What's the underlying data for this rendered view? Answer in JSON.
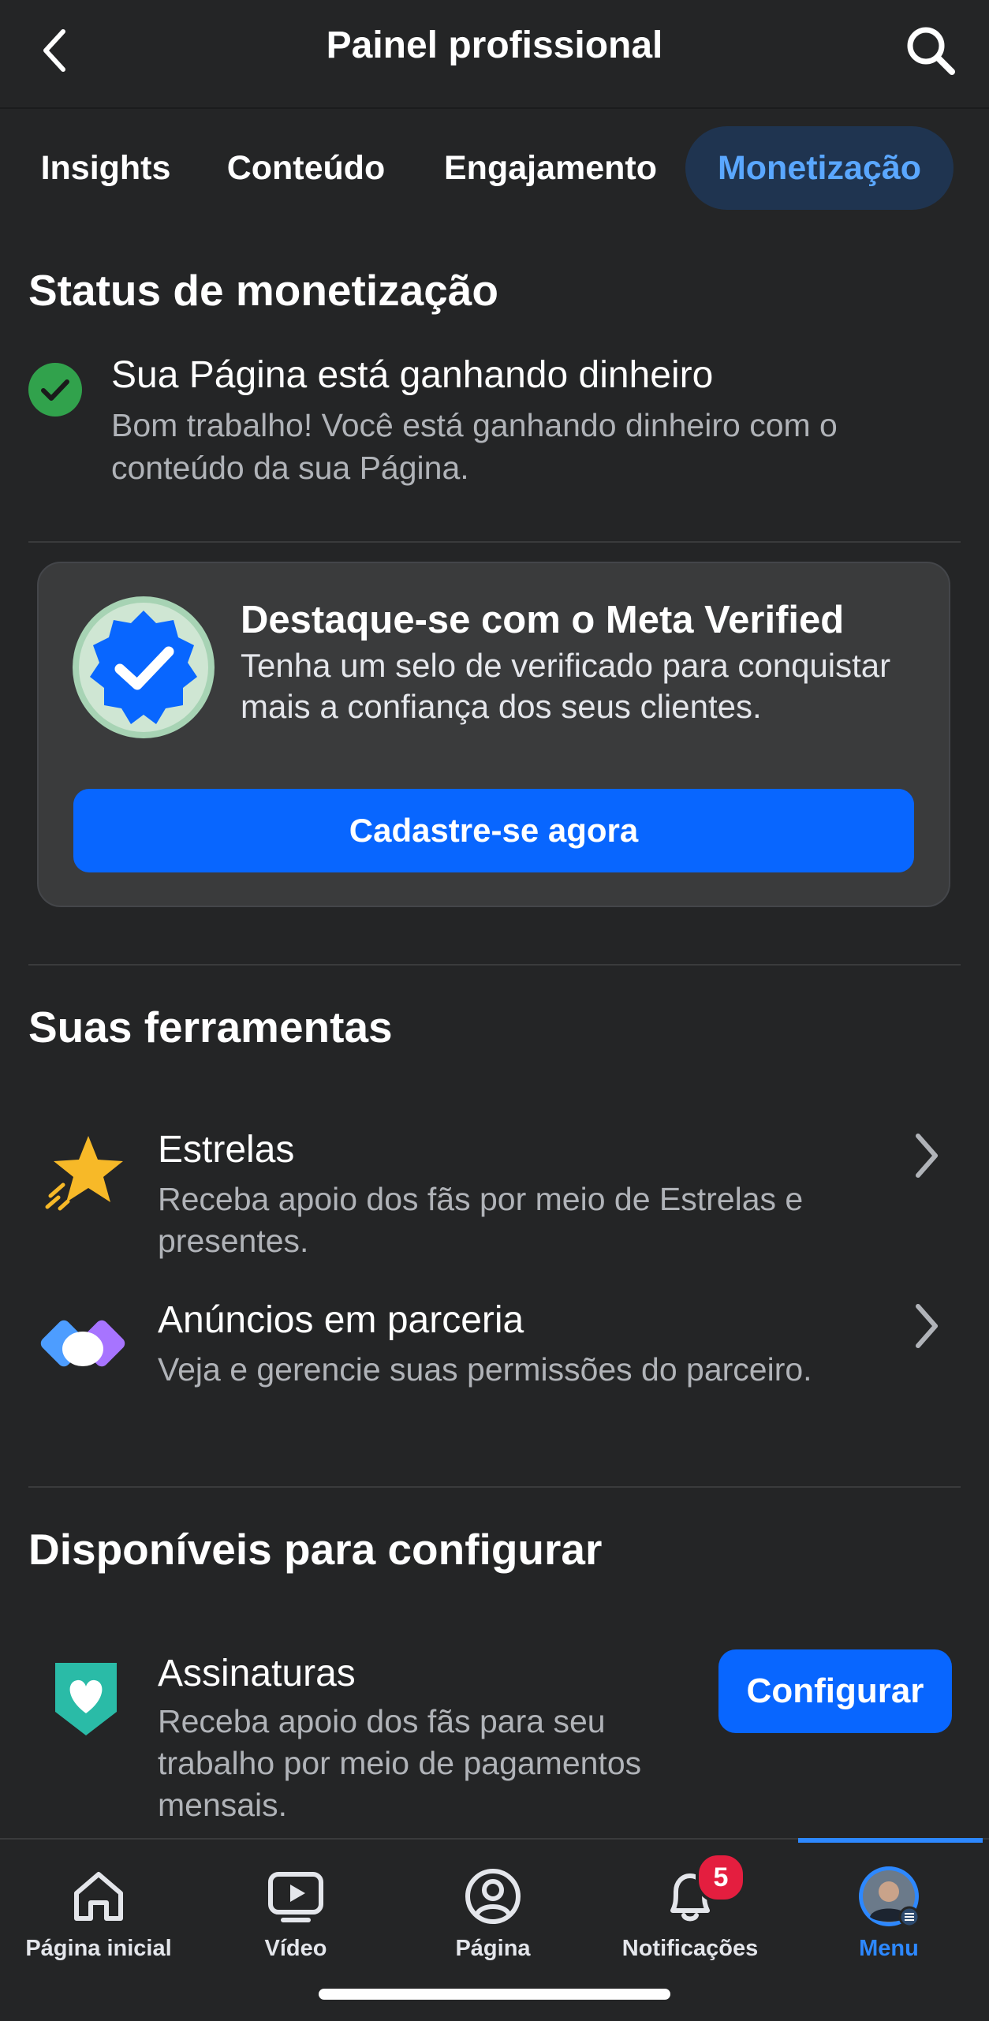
{
  "header": {
    "title": "Painel profissional"
  },
  "tabs": [
    {
      "label": "Insights",
      "active": false
    },
    {
      "label": "Conteúdo",
      "active": false
    },
    {
      "label": "Engajamento",
      "active": false
    },
    {
      "label": "Monetização",
      "active": true
    }
  ],
  "status": {
    "section_title": "Status de monetização",
    "main": "Sua Página está ganhando dinheiro",
    "sub": "Bom trabalho! Você está ganhando dinheiro com o conteúdo da sua Página."
  },
  "meta_verified": {
    "title": "Destaque-se com o Meta Verified",
    "body": "Tenha um selo de verificado para conquistar mais a confiança dos seus clientes.",
    "cta": "Cadastre-se agora"
  },
  "tools": {
    "section_title": "Suas ferramentas",
    "items": [
      {
        "title": "Estrelas",
        "desc": "Receba apoio dos fãs por meio de Estrelas e presentes.",
        "icon": "star-icon"
      },
      {
        "title": "Anúncios em parceria",
        "desc": "Veja e gerencie suas permissões do parceiro.",
        "icon": "handshake-icon"
      }
    ]
  },
  "available": {
    "section_title": "Disponíveis para configurar",
    "items": [
      {
        "title": "Assinaturas",
        "desc": "Receba apoio dos fãs para seu trabalho por meio de pagamentos mensais.",
        "button": "Configurar",
        "icon": "heart-shield-icon"
      }
    ]
  },
  "bottom_nav": {
    "items": [
      {
        "label": "Página inicial",
        "icon": "home-icon"
      },
      {
        "label": "Vídeo",
        "icon": "video-icon"
      },
      {
        "label": "Página",
        "icon": "profile-icon"
      },
      {
        "label": "Notificações",
        "icon": "bell-icon"
      },
      {
        "label": "Menu",
        "icon": "avatar",
        "active": true
      }
    ],
    "notification_count": "5"
  },
  "colors": {
    "accent": "#0866ff",
    "background": "#242526",
    "success": "#31a24c"
  }
}
